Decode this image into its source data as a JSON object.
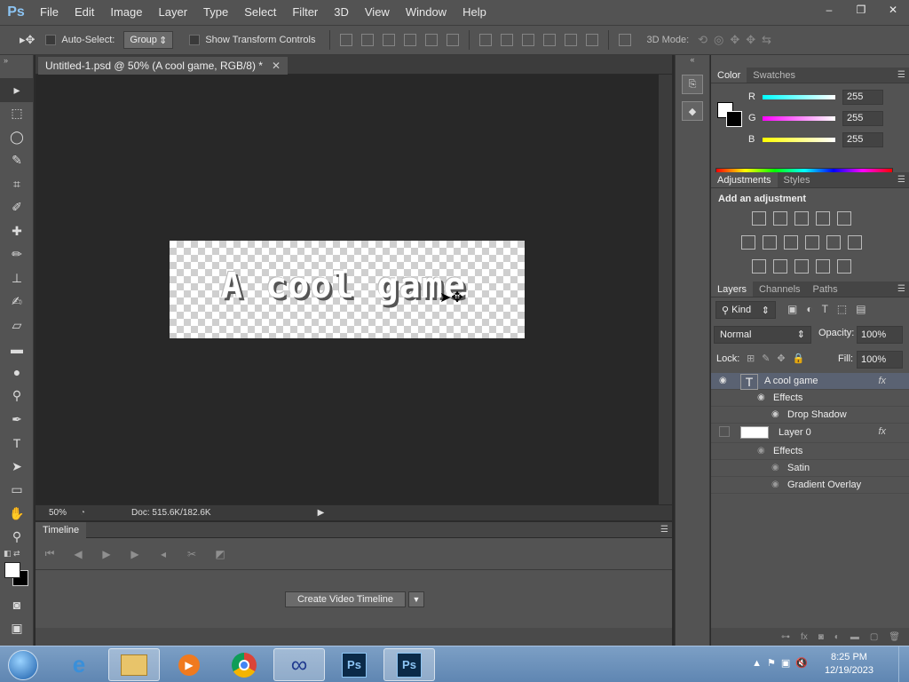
{
  "app": {
    "logo": "Ps"
  },
  "menu": [
    "File",
    "Edit",
    "Image",
    "Layer",
    "Type",
    "Select",
    "Filter",
    "3D",
    "View",
    "Window",
    "Help"
  ],
  "window_controls": [
    "–",
    "❐",
    "✕"
  ],
  "options": {
    "auto_select_label": "Auto-Select:",
    "auto_select_value": "Group",
    "transform_label": "Show Transform Controls",
    "mode_3d_label": "3D Mode:"
  },
  "document": {
    "tab_title": "Untitled-1.psd @ 50% (A cool game, RGB/8) *",
    "canvas_text": "A cool game",
    "zoom": "50%",
    "doc_info": "Doc: 515.6K/182.6K"
  },
  "timeline": {
    "tab": "Timeline",
    "create_button": "Create Video Timeline"
  },
  "color_panel": {
    "tabs": [
      "Color",
      "Swatches"
    ],
    "channels": [
      {
        "label": "R",
        "value": "255",
        "color": "#00ffff"
      },
      {
        "label": "G",
        "value": "255",
        "color": "#ff00ff"
      },
      {
        "label": "B",
        "value": "255",
        "color": "#ffff00"
      }
    ]
  },
  "adjustments_panel": {
    "tabs": [
      "Adjustments",
      "Styles"
    ],
    "title": "Add an adjustment"
  },
  "layers_panel": {
    "tabs": [
      "Layers",
      "Channels",
      "Paths"
    ],
    "kind": "Kind",
    "blend_mode": "Normal",
    "opacity_label": "Opacity:",
    "opacity": "100%",
    "lock_label": "Lock:",
    "fill_label": "Fill:",
    "fill": "100%",
    "layers": [
      {
        "name": "A cool game",
        "effects_label": "Effects",
        "effects": [
          "Drop Shadow"
        ]
      },
      {
        "name": "Layer 0",
        "effects_label": "Effects",
        "effects": [
          "Satin",
          "Gradient Overlay"
        ]
      }
    ]
  },
  "taskbar": {
    "time": "8:25 PM",
    "date": "12/19/2023"
  }
}
